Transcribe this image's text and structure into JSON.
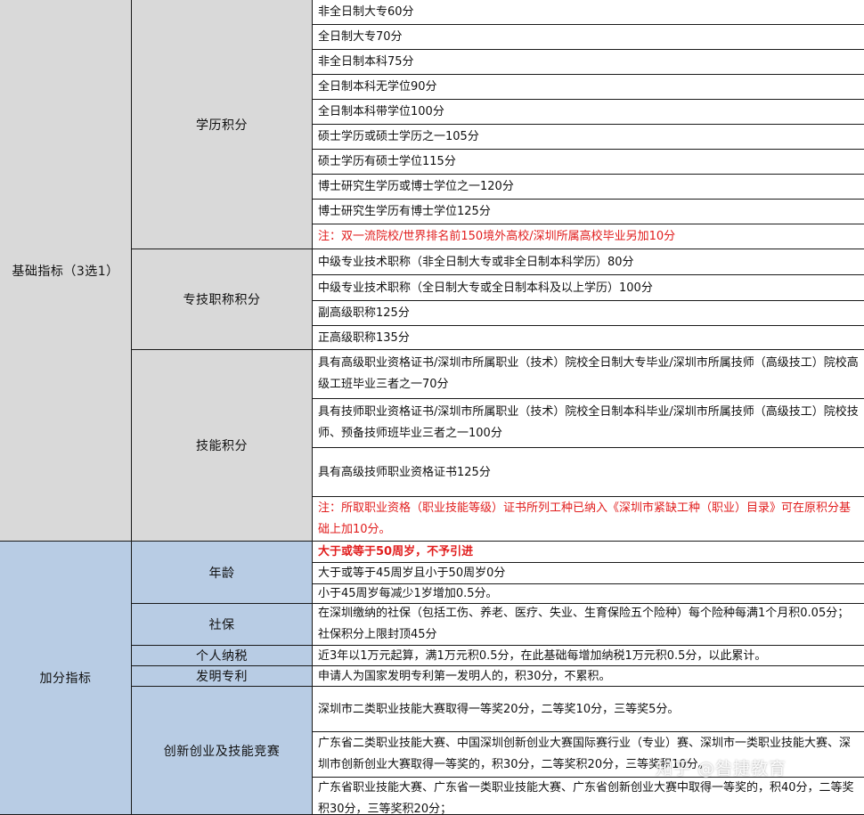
{
  "sections": {
    "base": "基础指标（3选1）",
    "bonus": "加分指标"
  },
  "groups": {
    "education": "学历积分",
    "title": "专技职称积分",
    "skill": "技能积分",
    "age": "年龄",
    "social": "社保",
    "tax": "个人纳税",
    "patent": "发明专利",
    "innovation": "创新创业及技能竞赛"
  },
  "education_items": [
    "非全日制大专60分",
    "全日制大专70分",
    "非全日制本科75分",
    "全日制本科无学位90分",
    "全日制本科带学位100分",
    "硕士学历或硕士学历之一105分",
    "硕士学历有硕士学位115分",
    "博士研究生学历或博士学位之一120分",
    "博士研究生学历有博士学位125分",
    "注：双一流院校/世界排名前150境外高校/深圳所属高校毕业另加10分"
  ],
  "title_items": [
    "中级专业技术职称（非全日制大专或非全日制本科学历）80分",
    "中级专业技术职称（全日制大专或全日制本科及以上学历）100分",
    "副高级职称125分",
    "正高级职称135分"
  ],
  "skill_items": [
    "具有高级职业资格证书/深圳市所属职业（技术）院校全日制大专毕业/深圳市所属技师（高级技工）院校高级工班毕业三者之一70分",
    "具有技师职业资格证书/深圳市所属职业（技术）院校全日制本科毕业/深圳市所属技师（高级技工）院校技师、预备技师班毕业三者之一100分",
    "具有高级技师职业资格证书125分",
    "注：所取职业资格（职业技能等级）证书所列工种已纳入《深圳市紧缺工种（职业）目录》可在原积分基础上加10分。"
  ],
  "age_items": [
    "大于或等于50周岁，不予引进",
    "大于或等于45周岁且小于50周岁0分",
    "小于45周岁每减少1岁增加0.5分。"
  ],
  "social_item": "在深圳缴纳的社保（包括工伤、养老、医疗、失业、生育保险五个险种）每个险种每满1个月积0.05分；社保积分上限封顶45分",
  "tax_item": "近3年以1万元起算，满1万元积0.5分，在此基础每增加纳税1万元积0.5分，以此累计。",
  "patent_item": "申请人为国家发明专利第一发明人的，积30分，不累积。",
  "innovation_items": [
    "深圳市二类职业技能大赛取得一等奖20分，二等奖10分，三等奖5分。",
    "广东省二类职业技能大赛、中国深圳创新创业大赛国际赛行业（专业）赛、深圳市一类职业技能大赛、深圳市创新创业大赛取得一等奖的，积30分，二等奖积20分，三等奖积10分。",
    "广东省职业技能大赛、广东省一类职业技能大赛、广东省创新创业大赛中取得一等奖的，积40分，二等奖积30分，三等奖积20分；"
  ],
  "watermark": "知乎 @昝捷教育",
  "colors": {
    "base_fill": "#d9d9d9",
    "bonus_fill": "#b8cce4",
    "note_red": "#e11d1d"
  }
}
